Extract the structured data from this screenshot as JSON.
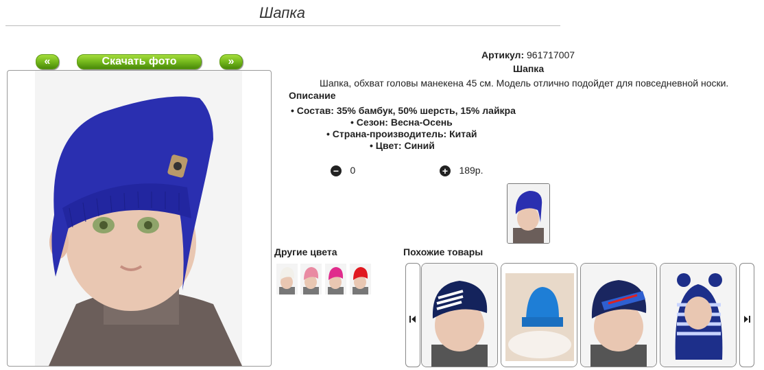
{
  "page_title": "Шапка",
  "gallery": {
    "prev_label": "«",
    "download_label": "Скачать фото",
    "next_label": "»"
  },
  "product": {
    "article_label": "Артикул:",
    "article_value": "961717007",
    "name": "Шапка",
    "description": "Шапка, обхват головы манекена 45 см. Модель отлично подойдет для повседневной носки.",
    "description_heading": "Описание",
    "specs": [
      "Состав: 35% бамбук, 50% шерсть, 15% лайкра",
      "Сезон: Весна-Осень",
      "Страна-производитель: Китай",
      "Цвет: Синий"
    ],
    "quantity": "0",
    "price": "189р."
  },
  "other_colors": {
    "heading": "Другие цвета"
  },
  "similar": {
    "heading": "Похожие товары"
  },
  "colors": {
    "accent_green": "#74b81c",
    "hat_blue": "#2a2fb0"
  }
}
